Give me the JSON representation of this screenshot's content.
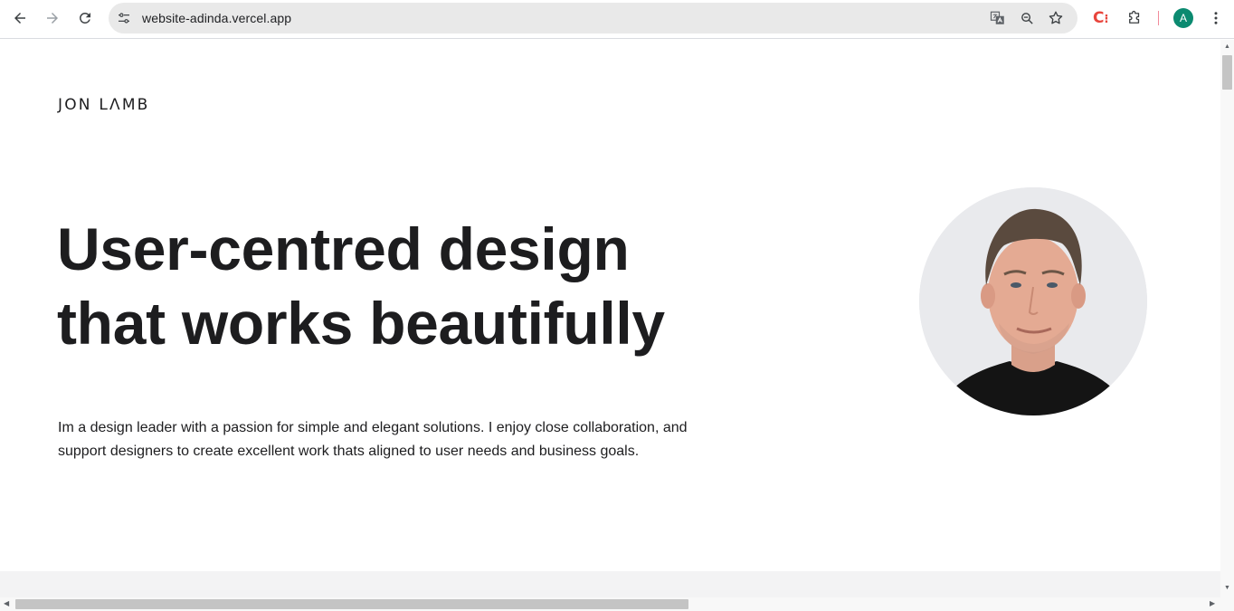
{
  "browser": {
    "url": "website-adinda.vercel.app",
    "profile_initial": "A",
    "icons": {
      "back": "arrow-left-icon",
      "forward": "arrow-right-icon",
      "reload": "reload-icon",
      "site_info": "tune-icon",
      "translate": "translate-icon",
      "zoom": "zoom-icon",
      "bookmark": "star-icon",
      "extension_c": "extension-c-icon",
      "extensions": "puzzle-icon",
      "menu": "kebab-menu-icon"
    },
    "extension_label": "C",
    "extension_dots": "⁝"
  },
  "page": {
    "logo": "JON LΛMB",
    "headline_line1": "User-centred design",
    "headline_line2": "that works beautifully",
    "intro": "Im a design leader with a passion for simple and elegant solutions. I enjoy close collaboration, and support designers to create excellent work thats aligned to user needs and business goals."
  },
  "scrollbars": {
    "vertical_position": 0.0,
    "horizontal_visible_fraction": 0.55
  },
  "colors": {
    "text": "#1d1d1f",
    "omnibox_bg": "#e9e9e9",
    "avatar_bg": "#0b8a70",
    "portrait_bg": "#e9eaed"
  }
}
